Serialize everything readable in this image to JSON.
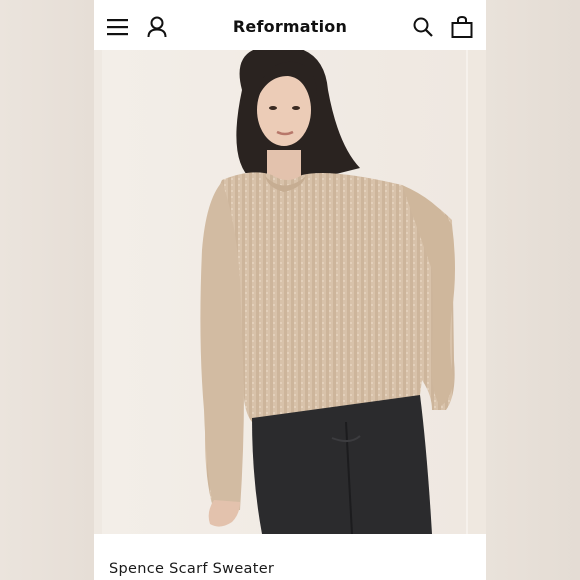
{
  "header": {
    "brand": "Reformation",
    "icons": {
      "menu": "hamburger-menu-icon",
      "account": "person-account-icon",
      "search": "search-icon",
      "bag": "shopping-bag-icon"
    }
  },
  "product": {
    "name": "Spence Scarf Sweater",
    "image": "model wearing beige knit sweater and black jeans"
  },
  "colors": {
    "sweater": "#d8c2aa",
    "background": "#f2ede8",
    "jeans": "#2b2b2d",
    "hair": "#2a2320"
  }
}
